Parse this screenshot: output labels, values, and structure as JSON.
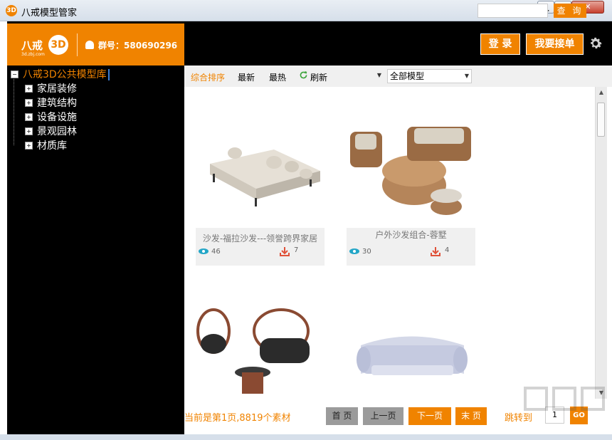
{
  "window": {
    "title": "八戒模型管家",
    "app_icon": "3D"
  },
  "header": {
    "logo_text": "八戒",
    "logo_3d": "3D",
    "logo_url": "3d.zbj.com",
    "group_label": "群号：580690296",
    "login_label": "登 录",
    "order_label": "我要接单",
    "brand_color": "#f08300"
  },
  "tree": {
    "root": "八戒3D公共模型库",
    "items": [
      {
        "label": "家居装修"
      },
      {
        "label": "建筑结构"
      },
      {
        "label": "设备设施"
      },
      {
        "label": "景观园林"
      },
      {
        "label": "材质库"
      }
    ]
  },
  "filters": {
    "sort_all": "综合排序",
    "sort_new": "最新",
    "sort_hot": "最热",
    "refresh": "刷新",
    "category_value": "",
    "model_type_value": "全部模型",
    "search_value": "",
    "search_button": "查 询"
  },
  "models": [
    {
      "name": "沙发-福拉沙发---领誉跨界家居",
      "views": "46",
      "downloads": "7"
    },
    {
      "name": "户外沙发组合-蓉墅",
      "views": "30",
      "downloads": "4"
    },
    {
      "name": "",
      "views": "",
      "downloads": ""
    },
    {
      "name": "",
      "views": "",
      "downloads": ""
    }
  ],
  "pager": {
    "info": "当前是第1页,8819个素材",
    "first": "首 页",
    "prev": "上一页",
    "next": "下一页",
    "last": "末 页",
    "jump_label": "跳转到",
    "jump_value": "1",
    "go": "GO"
  }
}
